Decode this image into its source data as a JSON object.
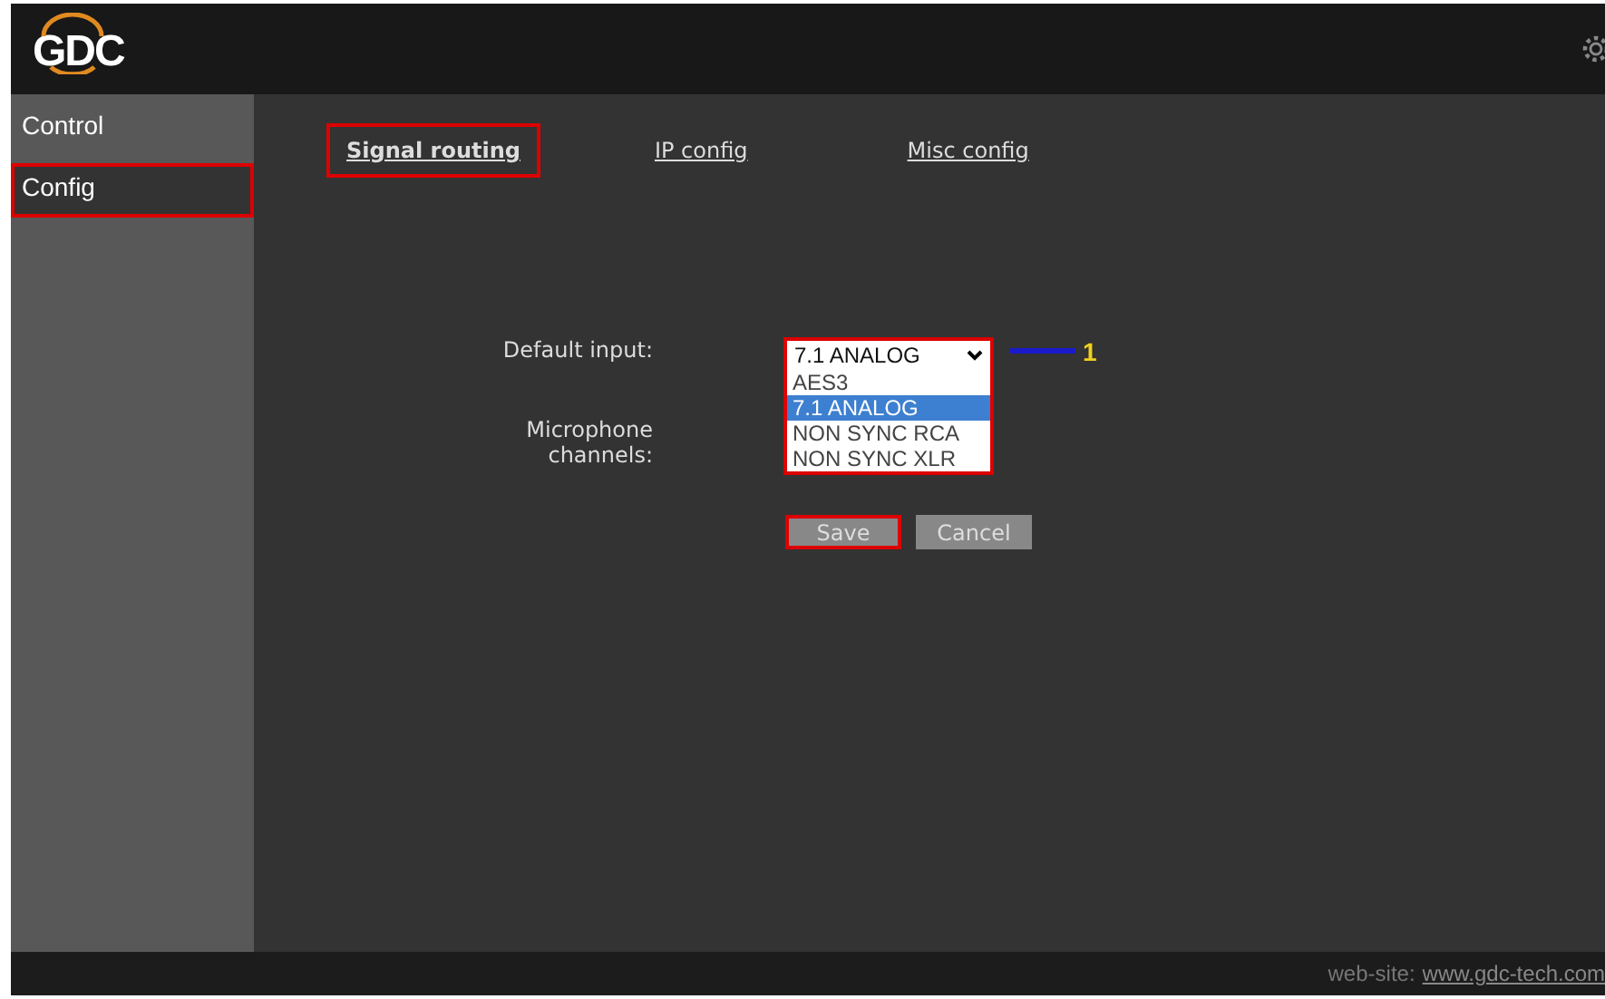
{
  "header": {
    "logo": "GDC"
  },
  "sidebar": {
    "items": [
      {
        "label": "Control",
        "selected": false,
        "highlighted": false
      },
      {
        "label": "Config",
        "selected": true,
        "highlighted": true
      }
    ]
  },
  "tabs": [
    {
      "label": "Signal routing",
      "selected": true,
      "highlighted": true
    },
    {
      "label": "IP config",
      "selected": false,
      "highlighted": false
    },
    {
      "label": "Misc config",
      "selected": false,
      "highlighted": false
    }
  ],
  "form": {
    "default_input": {
      "label": "Default input:",
      "value": "7.1 ANALOG",
      "expanded": true,
      "highlighted": true,
      "options": [
        {
          "label": "AES3",
          "selected": false
        },
        {
          "label": "7.1 ANALOG",
          "selected": true
        },
        {
          "label": "NON SYNC RCA",
          "selected": false
        },
        {
          "label": "NON SYNC XLR",
          "selected": false
        }
      ]
    },
    "microphone_channels": {
      "label": "Microphone channels:"
    }
  },
  "buttons": [
    {
      "label": "Save",
      "highlighted": true
    },
    {
      "label": "Cancel",
      "highlighted": false
    }
  ],
  "callout": {
    "label": "1"
  },
  "footer": {
    "prefix": "web-site:",
    "link": "www.gdc-tech.com"
  }
}
